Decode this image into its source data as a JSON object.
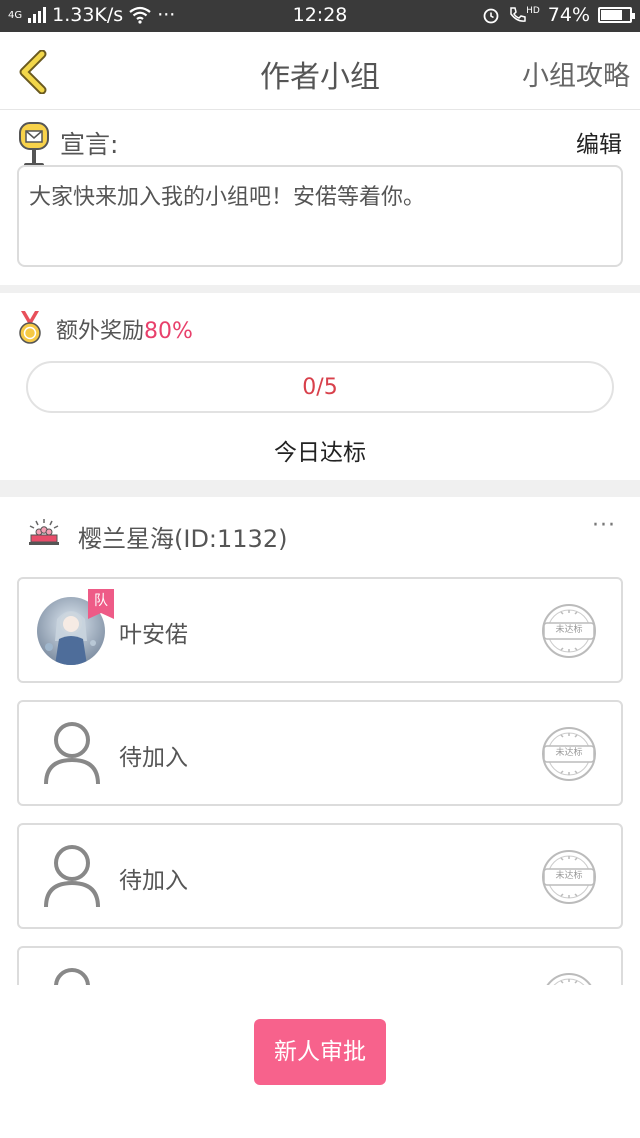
{
  "status_bar": {
    "network": "4G",
    "speed": "1.33K/s",
    "dots": "···",
    "time": "12:28",
    "hd": "HD",
    "battery_text": "74%",
    "battery_level": 0.74
  },
  "nav": {
    "title": "作者小组",
    "right_link": "小组攻略"
  },
  "declaration": {
    "label": "宣言:",
    "edit_label": "编辑",
    "text": "大家快来加入我的小组吧！安偌等着你。"
  },
  "bonus": {
    "label": "额外奖励",
    "percent": "80%",
    "progress_text": "0/5",
    "progress_fraction": 0.0,
    "today_label": "今日达标"
  },
  "group": {
    "name": "樱兰星海(ID:1132)",
    "more": "···"
  },
  "members": [
    {
      "name": "叶安偌",
      "badge": "队",
      "stamp": "未达标",
      "has_avatar": true
    },
    {
      "name": "待加入",
      "stamp": "未达标",
      "has_avatar": false
    },
    {
      "name": "待加入",
      "stamp": "未达标",
      "has_avatar": false
    },
    {
      "name": "",
      "stamp": "",
      "has_avatar": false
    }
  ],
  "approve_button": "新人审批",
  "colors": {
    "accent_pink": "#f7628c",
    "progress_red": "#d8404b",
    "percent_red": "#e8406b",
    "back_arrow": "#f2d74a"
  }
}
